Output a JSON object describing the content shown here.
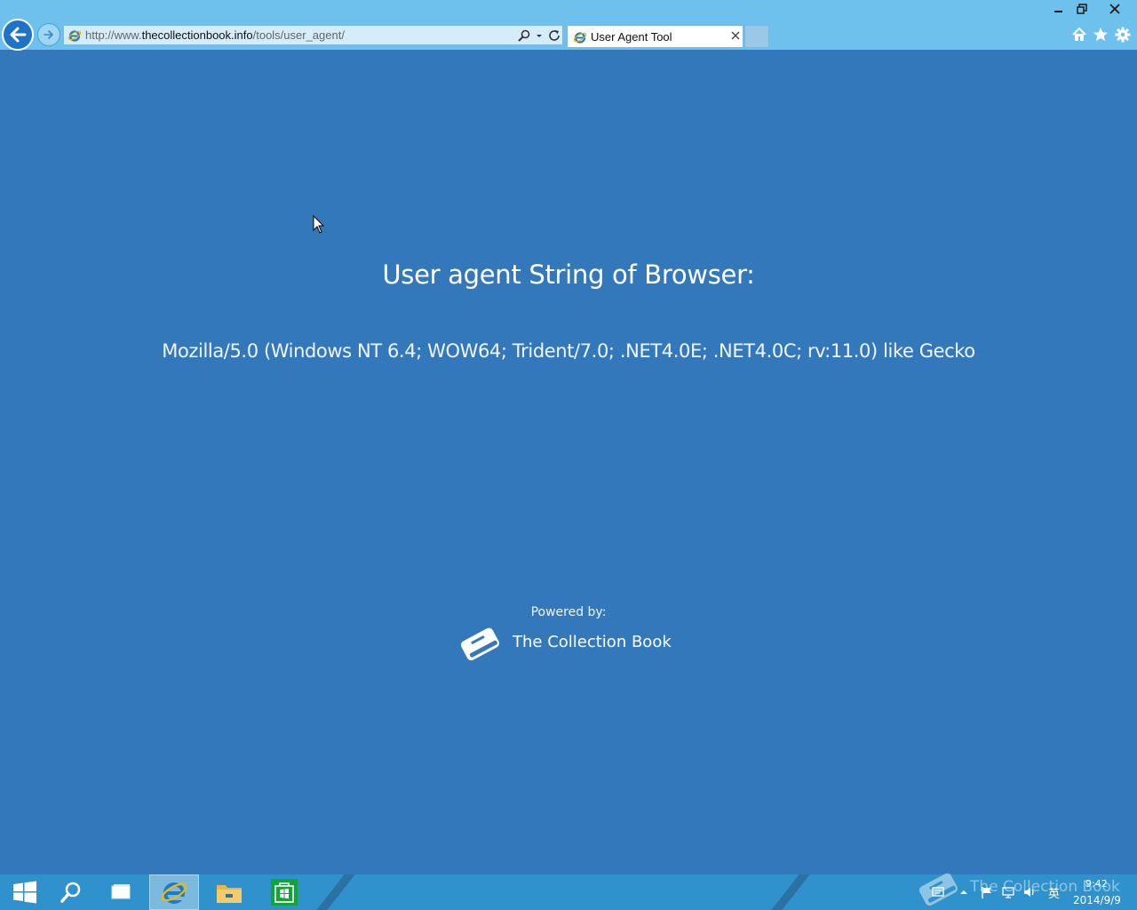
{
  "browser": {
    "url_prefix": "http://www.",
    "url_domain": "thecollectionbook.info",
    "url_path": "/tools/user_agent/",
    "tab_title": "User Agent Tool"
  },
  "page": {
    "heading": "User agent String of Browser:",
    "ua_string": "Mozilla/5.0 (Windows NT 6.4; WOW64; Trident/7.0; .NET4.0E; .NET4.0C; rv:11.0) like Gecko",
    "powered_label": "Powered by:",
    "brand_name": "The Collection Book"
  },
  "taskbar": {
    "watermark_text": "The Collection Book",
    "ime_label": "英",
    "clock_time": "9:42",
    "clock_date": "2014/9/9"
  },
  "colors": {
    "page_background": "#3478bc",
    "chrome_background": "#6ec1ec",
    "taskbar_background": "#2f92cc",
    "back_button": "#1e72c8"
  },
  "icons": [
    "back-arrow-icon",
    "forward-arrow-icon",
    "ie-icon",
    "search-icon",
    "dropdown-icon",
    "refresh-icon",
    "close-icon",
    "minimize-icon",
    "restore-icon",
    "home-icon",
    "favorites-star-icon",
    "gear-icon",
    "book-logo-icon",
    "windows-start-icon",
    "task-view-icon",
    "file-explorer-icon",
    "store-icon",
    "flag-icon",
    "network-icon",
    "volume-icon",
    "mouse-cursor-icon"
  ]
}
